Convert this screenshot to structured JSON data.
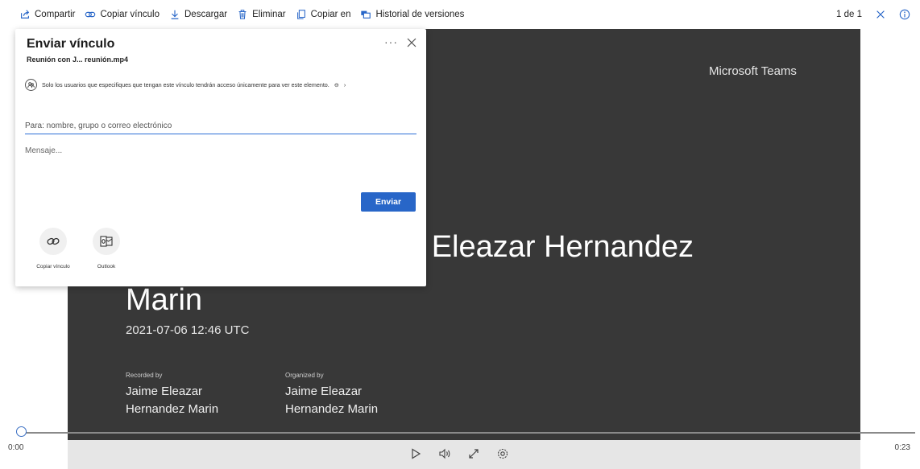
{
  "toolbar": {
    "share": "Compartir",
    "copy_link": "Copiar vínculo",
    "download": "Descargar",
    "delete": "Eliminar",
    "copy_to": "Copiar en",
    "version_history": "Historial de versiones",
    "page_count": "1 de 1"
  },
  "video": {
    "brand": "Microsoft Teams",
    "title_line1": "e Eleazar Hernandez",
    "title_line2": "Marin",
    "datetime": "2021-07-06 12:46 UTC",
    "recorded_by_label": "Recorded by",
    "recorded_by_name": "Jaime Eleazar Hernandez Marin",
    "organized_by_label": "Organized by",
    "organized_by_name": "Jaime Eleazar Hernandez Marin"
  },
  "player": {
    "current_time": "0:00",
    "duration": "0:23",
    "progress": 0
  },
  "dialog": {
    "title": "Enviar vínculo",
    "subtitle": "Reunión con J... reunión.mp4",
    "permission_text": "Solo los usuarios que especifiques que tengan este vínculo tendrán acceso únicamente para ver este elemento.",
    "to_placeholder": "Para: nombre, grupo o correo electrónico",
    "message_placeholder": "Mensaje...",
    "send_label": "Enviar",
    "options": [
      {
        "label": "Copiar vínculo",
        "icon": "link-icon"
      },
      {
        "label": "Outlook",
        "icon": "outlook-icon"
      }
    ]
  },
  "colors": {
    "accent": "#2866c8",
    "video_bg": "#383838"
  }
}
